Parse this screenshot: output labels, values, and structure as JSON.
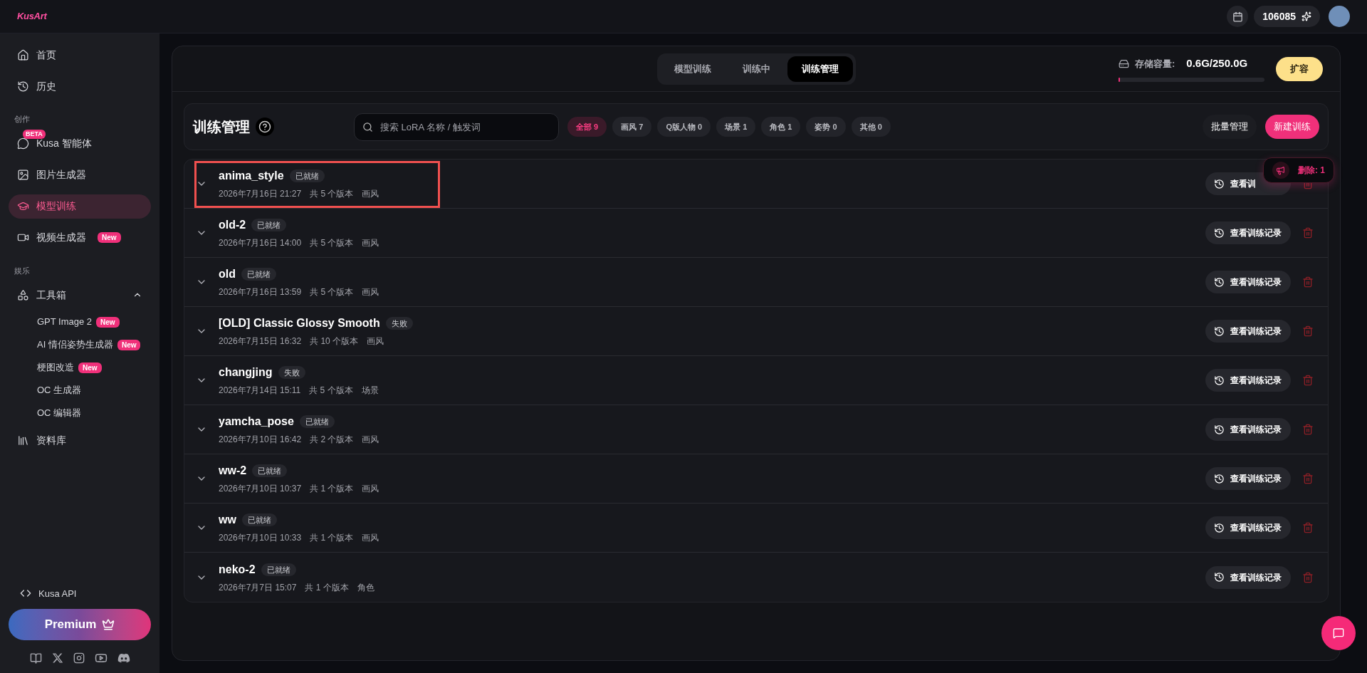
{
  "top_bar": {
    "logo": "KusArt",
    "credits": "106085"
  },
  "sidebar": {
    "items": [
      {
        "kind": "item",
        "label": "首页",
        "selected": false
      },
      {
        "kind": "item",
        "label": "历史",
        "selected": false
      },
      {
        "kind": "section",
        "label": "创作"
      },
      {
        "kind": "item",
        "label": "Kusa 智能体",
        "selected": false,
        "top_badge": "BETA"
      },
      {
        "kind": "item",
        "label": "图片生成器",
        "selected": false
      },
      {
        "kind": "item",
        "label": "模型训练",
        "selected": true
      },
      {
        "kind": "item",
        "label": "视频生成器",
        "selected": false,
        "badge": "New"
      },
      {
        "kind": "section",
        "label": "娱乐"
      },
      {
        "kind": "group",
        "label": "工具箱",
        "expanded": true,
        "children": [
          {
            "label": "GPT Image 2",
            "badge": "New"
          },
          {
            "label": "AI 情侣姿势生成器",
            "badge": "New"
          },
          {
            "label": "梗图改造",
            "badge": "New"
          },
          {
            "label": "OC 生成器"
          },
          {
            "label": "OC 编辑器"
          }
        ]
      },
      {
        "kind": "item",
        "label": "资料库",
        "selected": false
      }
    ],
    "api_link": "Kusa API",
    "premium_button": "Premium"
  },
  "tabs": [
    {
      "label": "模型训练",
      "selected": false
    },
    {
      "label": "训练中",
      "selected": false
    },
    {
      "label": "训练管理",
      "selected": true
    }
  ],
  "storage": {
    "label": "存储容量:",
    "value": "0.6G/250.0G",
    "level": 0.003,
    "button": "扩容"
  },
  "toolbar": {
    "title": "训练管理",
    "search": {
      "placeholder": "搜索 LoRA 名称 / 触发词"
    },
    "filters": [
      {
        "label": "全部 9",
        "selected": true
      },
      {
        "label": "画风 7",
        "selected": false
      },
      {
        "label": "Q版人物 0",
        "selected": false
      },
      {
        "label": "场景 1",
        "selected": false
      },
      {
        "label": "角色 1",
        "selected": false
      },
      {
        "label": "姿势 0",
        "selected": false
      },
      {
        "label": "其他 0",
        "selected": false
      }
    ],
    "batch_button": "批量管理",
    "new_button": "新建训练"
  },
  "rows": [
    {
      "name": "anima_style",
      "status": "已就绪",
      "date": "2026年7月16日 21:27",
      "versions": "共 5 个版本",
      "category": "画风",
      "button": "查看训",
      "highlighted": true
    },
    {
      "name": "old-2",
      "status": "已就绪",
      "date": "2026年7月16日 14:00",
      "versions": "共 5 个版本",
      "category": "画风",
      "button": "查看训练记录",
      "highlighted": false
    },
    {
      "name": "old",
      "status": "已就绪",
      "date": "2026年7月16日 13:59",
      "versions": "共 5 个版本",
      "category": "画风",
      "button": "查看训练记录",
      "highlighted": false
    },
    {
      "name": "[OLD] Classic Glossy Smooth",
      "status": "失败",
      "date": "2026年7月15日 16:32",
      "versions": "共 10 个版本",
      "category": "画风",
      "button": "查看训练记录",
      "highlighted": false
    },
    {
      "name": "changjing",
      "status": "失败",
      "date": "2026年7月14日 15:11",
      "versions": "共 5 个版本",
      "category": "场景",
      "button": "查看训练记录",
      "highlighted": false
    },
    {
      "name": "yamcha_pose",
      "status": "已就绪",
      "date": "2026年7月10日 16:42",
      "versions": "共 2 个版本",
      "category": "画风",
      "button": "查看训练记录",
      "highlighted": false
    },
    {
      "name": "ww-2",
      "status": "已就绪",
      "date": "2026年7月10日 10:37",
      "versions": "共 1 个版本",
      "category": "画风",
      "button": "查看训练记录",
      "highlighted": false
    },
    {
      "name": "ww",
      "status": "已就绪",
      "date": "2026年7月10日 10:33",
      "versions": "共 1 个版本",
      "category": "画风",
      "button": "查看训练记录",
      "highlighted": false
    },
    {
      "name": "neko-2",
      "status": "已就绪",
      "date": "2026年7月7日 15:07",
      "versions": "共 1 个版本",
      "category": "角色",
      "button": "查看训练记录",
      "highlighted": false
    }
  ],
  "toast": {
    "text": "删除: 1"
  }
}
